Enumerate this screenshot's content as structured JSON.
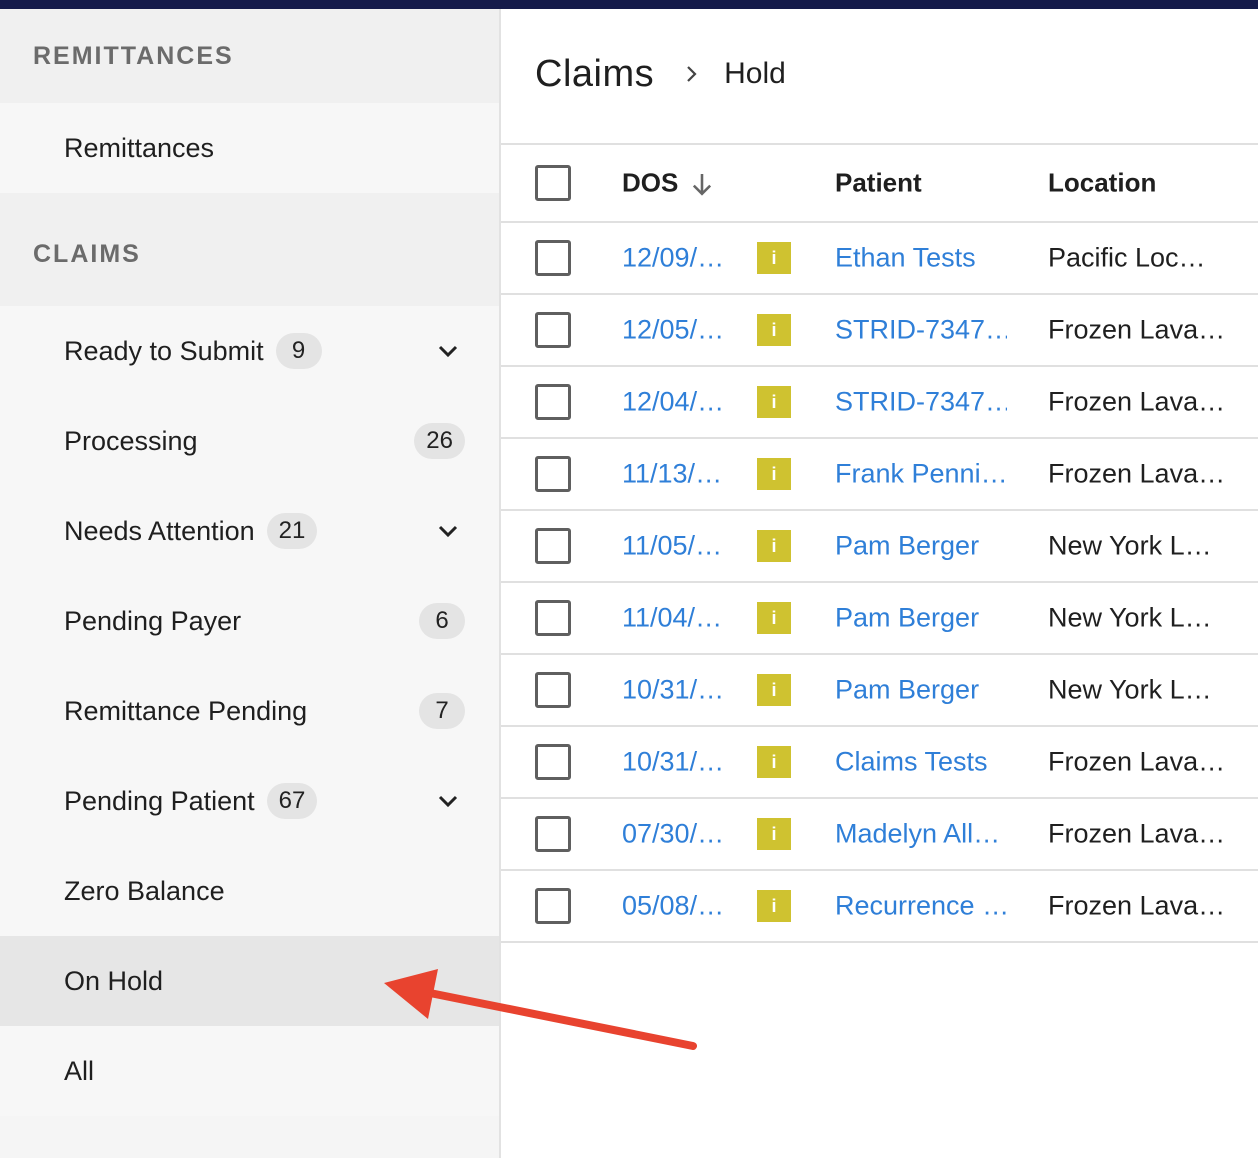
{
  "sidebar": {
    "remittances_header": "REMITTANCES",
    "remittances_item": "Remittances",
    "claims_header": "CLAIMS",
    "items": [
      {
        "label": "Ready to Submit",
        "count": "9",
        "expandable": true
      },
      {
        "label": "Processing",
        "count": "26",
        "expandable": false
      },
      {
        "label": "Needs Attention",
        "count": "21",
        "expandable": true
      },
      {
        "label": "Pending Payer",
        "count": "6",
        "expandable": false
      },
      {
        "label": "Remittance Pending",
        "count": "7",
        "expandable": false
      },
      {
        "label": "Pending Patient",
        "count": "67",
        "expandable": true
      },
      {
        "label": "Zero Balance"
      },
      {
        "label": "On Hold",
        "active": true
      },
      {
        "label": "All"
      }
    ]
  },
  "breadcrumb": {
    "root": "Claims",
    "current": "Hold"
  },
  "table": {
    "columns": {
      "dos": "DOS",
      "patient": "Patient",
      "location": "Location"
    },
    "info_icon": "i",
    "rows": [
      {
        "dos": "12/09/…",
        "patient": "Ethan Tests",
        "location": "Pacific Loc…"
      },
      {
        "dos": "12/05/…",
        "patient": "STRID-7347…",
        "location": "Frozen Lava…"
      },
      {
        "dos": "12/04/…",
        "patient": "STRID-7347…",
        "location": "Frozen Lava…"
      },
      {
        "dos": "11/13/…",
        "patient": "Frank Penni…",
        "location": "Frozen Lava…"
      },
      {
        "dos": "11/05/…",
        "patient": "Pam Berger",
        "location": "New York L…"
      },
      {
        "dos": "11/04/…",
        "patient": "Pam Berger",
        "location": "New York L…"
      },
      {
        "dos": "10/31/…",
        "patient": "Pam Berger",
        "location": "New York L…"
      },
      {
        "dos": "10/31/…",
        "patient": "Claims Tests",
        "location": "Frozen Lava…"
      },
      {
        "dos": "07/30/…",
        "patient": "Madelyn All…",
        "location": "Frozen Lava…"
      },
      {
        "dos": "05/08/…",
        "patient": "Recurrence …",
        "location": "Frozen Lava…"
      }
    ]
  },
  "colors": {
    "accent_link": "#2f7fd8",
    "info_badge": "#cfc230",
    "annotation_arrow": "#e8432f",
    "topbar": "#151b4a"
  }
}
